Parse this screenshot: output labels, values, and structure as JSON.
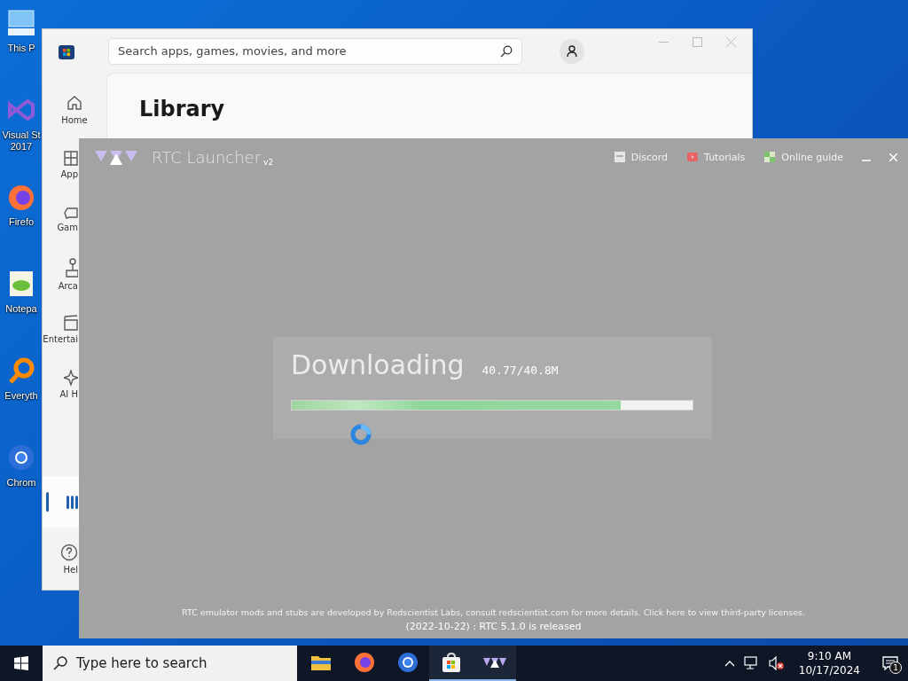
{
  "desktop_icons": [
    {
      "kind": "computer",
      "label": "This P"
    },
    {
      "kind": "visualstudio",
      "label": "Visual St\n2017"
    },
    {
      "kind": "firefox",
      "label": "Firefo"
    },
    {
      "kind": "notepad",
      "label": "Notepa"
    },
    {
      "kind": "everything",
      "label": "Everyth"
    },
    {
      "kind": "chrome",
      "label": "Chrom"
    }
  ],
  "store_window": {
    "search": {
      "placeholder": "Search apps, games, movies, and more"
    },
    "heading": "Library",
    "nav_items": [
      {
        "kind": "home",
        "label": "Home",
        "selected": false
      },
      {
        "kind": "apps",
        "label": "App",
        "selected": false
      },
      {
        "kind": "gaming",
        "label": "Gam",
        "selected": false
      },
      {
        "kind": "arcade",
        "label": "Arca",
        "selected": false
      },
      {
        "kind": "entertainment",
        "label": "Entertai",
        "selected": false
      },
      {
        "kind": "ai",
        "label": "AI H",
        "selected": false
      },
      {
        "kind": "library",
        "selected": true
      },
      {
        "kind": "help",
        "label": "Hel",
        "selected": false
      }
    ]
  },
  "launcher": {
    "title": "RTC Launcher",
    "version": "v2",
    "links": [
      {
        "kind": "discord",
        "label": "Discord"
      },
      {
        "kind": "tutorials",
        "label": "Tutorials"
      },
      {
        "kind": "guide",
        "label": "Online guide"
      }
    ],
    "download": {
      "status": "Downloading",
      "size": "40.77/40.8M",
      "level": 0.82
    },
    "footer": "RTC emulator mods and stubs are developed by Redscientist Labs, consult redscientist.com for more details. Click here to view third-party licenses.",
    "release": "(2022-10-22) : RTC 5.1.0 is released"
  },
  "taskbar": {
    "search": {
      "placeholder": "Type here to search"
    },
    "apps": [
      {
        "kind": "folder",
        "running": false
      },
      {
        "kind": "firefox",
        "running": false
      },
      {
        "kind": "chrome",
        "running": false
      },
      {
        "kind": "store",
        "running": true
      },
      {
        "kind": "launcher",
        "running": true
      }
    ],
    "time": "9:10 AM",
    "date": "10/17/2024",
    "notifications": "1"
  }
}
